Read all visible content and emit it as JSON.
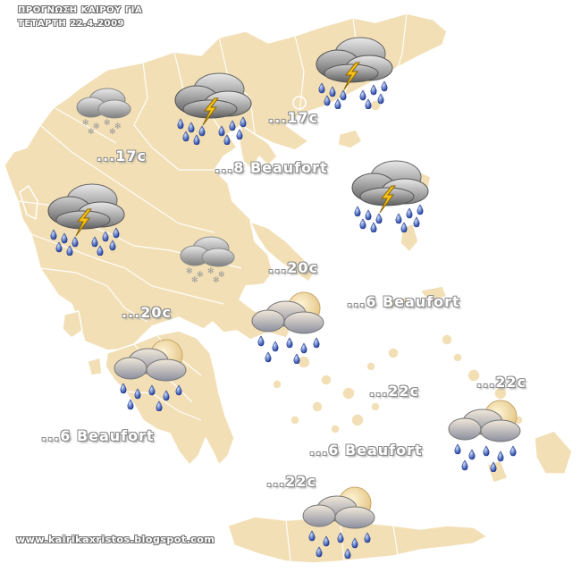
{
  "header": {
    "title": "ΠΡΟΓΝΩΣΗ ΚΑΙΡΟΥ ΓΙΑ",
    "date": "ΤΕΤΑΡΤΗ 22.4.2009"
  },
  "labels": {
    "temp_north_east": "...17c",
    "temp_north_west": "...17c",
    "wind_north_aegean": "...8 Beaufort",
    "temp_central_aegean": "...20c",
    "temp_west": "...20c",
    "wind_east_aegean": "...6 Beaufort",
    "temp_cyclades": "...22c",
    "temp_dodecanese": "...22c",
    "wind_ionian": "...6 Beaufort",
    "wind_south_aegean": "...6 Beaufort",
    "temp_crete": "...22c"
  },
  "footer": {
    "url": "www.kairikaxristos.blogspot.com"
  },
  "colors": {
    "land": "#f2dfb5",
    "borders": "#ffffff",
    "sea": "#ffffff",
    "label_text": "#ffffff",
    "label_outline": "#8c8c8c",
    "rain": "#2f4db8",
    "lightning": "#f7c21a"
  },
  "icons": {
    "thrace": "thunderstorm-icon",
    "macedonia": "thunderstorm-icon",
    "epirus_north": "snow-cloud-icon",
    "epirus": "thunderstorm-icon",
    "lesvos": "thunderstorm-icon",
    "thessaly": "snow-cloud-icon",
    "attica": "rain-sun-icon",
    "peloponnese": "rain-sun-icon",
    "dodecanese": "rain-sun-icon",
    "crete": "rain-sun-icon"
  }
}
